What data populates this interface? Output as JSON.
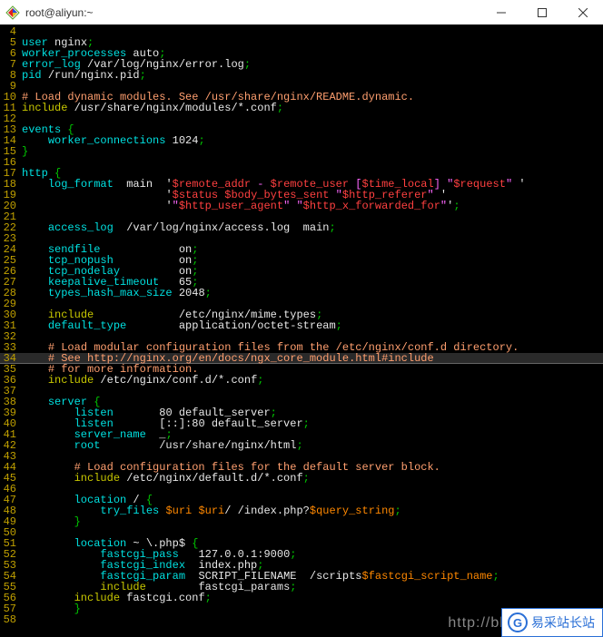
{
  "titlebar": {
    "text": "root@aliyun:~"
  },
  "code_lines": [
    {
      "n": 4,
      "tokens": []
    },
    {
      "n": 5,
      "tokens": [
        {
          "t": "user ",
          "c": "cyan"
        },
        {
          "t": "nginx",
          "c": "white"
        },
        {
          "t": ";",
          "c": "green"
        }
      ]
    },
    {
      "n": 6,
      "tokens": [
        {
          "t": "worker_processes ",
          "c": "cyan"
        },
        {
          "t": "auto",
          "c": "white"
        },
        {
          "t": ";",
          "c": "green"
        }
      ]
    },
    {
      "n": 7,
      "tokens": [
        {
          "t": "error_log ",
          "c": "cyan"
        },
        {
          "t": "/var/log/nginx/error.log",
          "c": "white"
        },
        {
          "t": ";",
          "c": "green"
        }
      ]
    },
    {
      "n": 8,
      "tokens": [
        {
          "t": "pid ",
          "c": "cyan"
        },
        {
          "t": "/run/nginx.pid",
          "c": "white"
        },
        {
          "t": ";",
          "c": "green"
        }
      ]
    },
    {
      "n": 9,
      "tokens": []
    },
    {
      "n": 10,
      "tokens": [
        {
          "t": "# Load dynamic modules. See /usr/share/nginx/README.dynamic.",
          "c": "salmon"
        }
      ]
    },
    {
      "n": 11,
      "tokens": [
        {
          "t": "include ",
          "c": "yellow"
        },
        {
          "t": "/usr/share/nginx/modules/*.conf",
          "c": "white"
        },
        {
          "t": ";",
          "c": "green"
        }
      ]
    },
    {
      "n": 12,
      "tokens": []
    },
    {
      "n": 13,
      "tokens": [
        {
          "t": "events ",
          "c": "cyan"
        },
        {
          "t": "{",
          "c": "green"
        }
      ]
    },
    {
      "n": 14,
      "tokens": [
        {
          "t": "    ",
          "c": "white"
        },
        {
          "t": "worker_connections ",
          "c": "cyan"
        },
        {
          "t": "1024",
          "c": "white"
        },
        {
          "t": ";",
          "c": "green"
        }
      ]
    },
    {
      "n": 15,
      "tokens": [
        {
          "t": "}",
          "c": "green"
        }
      ]
    },
    {
      "n": 16,
      "tokens": []
    },
    {
      "n": 17,
      "tokens": [
        {
          "t": "http ",
          "c": "cyan"
        },
        {
          "t": "{",
          "c": "green"
        }
      ]
    },
    {
      "n": 18,
      "tokens": [
        {
          "t": "    ",
          "c": "white"
        },
        {
          "t": "log_format",
          "c": "cyan"
        },
        {
          "t": "  main  ",
          "c": "white"
        },
        {
          "t": "'",
          "c": "white"
        },
        {
          "t": "$remote_addr",
          "c": "red"
        },
        {
          "t": " - ",
          "c": "magenta"
        },
        {
          "t": "$remote_user",
          "c": "red"
        },
        {
          "t": " [",
          "c": "magenta"
        },
        {
          "t": "$time_local",
          "c": "red"
        },
        {
          "t": "] \"",
          "c": "magenta"
        },
        {
          "t": "$request",
          "c": "red"
        },
        {
          "t": "\" ",
          "c": "magenta"
        },
        {
          "t": "'",
          "c": "white"
        }
      ]
    },
    {
      "n": 19,
      "tokens": [
        {
          "t": "                      ",
          "c": "white"
        },
        {
          "t": "'",
          "c": "white"
        },
        {
          "t": "$status",
          "c": "red"
        },
        {
          "t": " ",
          "c": "magenta"
        },
        {
          "t": "$body_bytes_sent",
          "c": "red"
        },
        {
          "t": " \"",
          "c": "magenta"
        },
        {
          "t": "$http_referer",
          "c": "red"
        },
        {
          "t": "\" ",
          "c": "magenta"
        },
        {
          "t": "'",
          "c": "white"
        }
      ]
    },
    {
      "n": 20,
      "tokens": [
        {
          "t": "                      ",
          "c": "white"
        },
        {
          "t": "'",
          "c": "white"
        },
        {
          "t": "\"",
          "c": "magenta"
        },
        {
          "t": "$http_user_agent",
          "c": "red"
        },
        {
          "t": "\" \"",
          "c": "magenta"
        },
        {
          "t": "$http_x_forwarded_for",
          "c": "red"
        },
        {
          "t": "\"",
          "c": "magenta"
        },
        {
          "t": "'",
          "c": "white"
        },
        {
          "t": ";",
          "c": "green"
        }
      ]
    },
    {
      "n": 21,
      "tokens": []
    },
    {
      "n": 22,
      "tokens": [
        {
          "t": "    ",
          "c": "white"
        },
        {
          "t": "access_log",
          "c": "cyan"
        },
        {
          "t": "  /var/log/nginx/access.log  main",
          "c": "white"
        },
        {
          "t": ";",
          "c": "green"
        }
      ]
    },
    {
      "n": 23,
      "tokens": []
    },
    {
      "n": 24,
      "tokens": [
        {
          "t": "    ",
          "c": "white"
        },
        {
          "t": "sendfile",
          "c": "cyan"
        },
        {
          "t": "            ",
          "c": "white"
        },
        {
          "t": "on",
          "c": "white"
        },
        {
          "t": ";",
          "c": "green"
        }
      ]
    },
    {
      "n": 25,
      "tokens": [
        {
          "t": "    ",
          "c": "white"
        },
        {
          "t": "tcp_nopush",
          "c": "cyan"
        },
        {
          "t": "          ",
          "c": "white"
        },
        {
          "t": "on",
          "c": "white"
        },
        {
          "t": ";",
          "c": "green"
        }
      ]
    },
    {
      "n": 26,
      "tokens": [
        {
          "t": "    ",
          "c": "white"
        },
        {
          "t": "tcp_nodelay",
          "c": "cyan"
        },
        {
          "t": "         ",
          "c": "white"
        },
        {
          "t": "on",
          "c": "white"
        },
        {
          "t": ";",
          "c": "green"
        }
      ]
    },
    {
      "n": 27,
      "tokens": [
        {
          "t": "    ",
          "c": "white"
        },
        {
          "t": "keepalive_timeout",
          "c": "cyan"
        },
        {
          "t": "   65",
          "c": "white"
        },
        {
          "t": ";",
          "c": "green"
        }
      ]
    },
    {
      "n": 28,
      "tokens": [
        {
          "t": "    ",
          "c": "white"
        },
        {
          "t": "types_hash_max_size",
          "c": "cyan"
        },
        {
          "t": " 2048",
          "c": "white"
        },
        {
          "t": ";",
          "c": "green"
        }
      ]
    },
    {
      "n": 29,
      "tokens": []
    },
    {
      "n": 30,
      "tokens": [
        {
          "t": "    ",
          "c": "white"
        },
        {
          "t": "include",
          "c": "yellow"
        },
        {
          "t": "             /etc/nginx/mime.types",
          "c": "white"
        },
        {
          "t": ";",
          "c": "green"
        }
      ]
    },
    {
      "n": 31,
      "tokens": [
        {
          "t": "    ",
          "c": "white"
        },
        {
          "t": "default_type",
          "c": "cyan"
        },
        {
          "t": "        application/octet-stream",
          "c": "white"
        },
        {
          "t": ";",
          "c": "green"
        }
      ]
    },
    {
      "n": 32,
      "tokens": []
    },
    {
      "n": 33,
      "tokens": [
        {
          "t": "    ",
          "c": "white"
        },
        {
          "t": "# Load modular configuration files from the /etc/nginx/conf.d directory.",
          "c": "salmon"
        }
      ]
    },
    {
      "n": 34,
      "cursor": true,
      "tokens": [
        {
          "t": "    ",
          "c": "white"
        },
        {
          "t": "# See http://nginx.org/en/docs/ngx_core_module.html#include",
          "c": "salmon"
        }
      ]
    },
    {
      "n": 35,
      "tokens": [
        {
          "t": "    ",
          "c": "white"
        },
        {
          "t": "# for more information.",
          "c": "salmon"
        }
      ]
    },
    {
      "n": 36,
      "tokens": [
        {
          "t": "    ",
          "c": "white"
        },
        {
          "t": "include",
          "c": "yellow"
        },
        {
          "t": " /etc/nginx/conf.d/*.conf",
          "c": "white"
        },
        {
          "t": ";",
          "c": "green"
        }
      ]
    },
    {
      "n": 37,
      "tokens": []
    },
    {
      "n": 38,
      "tokens": [
        {
          "t": "    ",
          "c": "white"
        },
        {
          "t": "server ",
          "c": "cyan"
        },
        {
          "t": "{",
          "c": "green"
        }
      ]
    },
    {
      "n": 39,
      "tokens": [
        {
          "t": "        ",
          "c": "white"
        },
        {
          "t": "listen",
          "c": "cyan"
        },
        {
          "t": "       80 default_server",
          "c": "white"
        },
        {
          "t": ";",
          "c": "green"
        }
      ]
    },
    {
      "n": 40,
      "tokens": [
        {
          "t": "        ",
          "c": "white"
        },
        {
          "t": "listen",
          "c": "cyan"
        },
        {
          "t": "       [::]:80 default_server",
          "c": "white"
        },
        {
          "t": ";",
          "c": "green"
        }
      ]
    },
    {
      "n": 41,
      "tokens": [
        {
          "t": "        ",
          "c": "white"
        },
        {
          "t": "server_name",
          "c": "cyan"
        },
        {
          "t": "  _",
          "c": "white"
        },
        {
          "t": ";",
          "c": "green"
        }
      ]
    },
    {
      "n": 42,
      "tokens": [
        {
          "t": "        ",
          "c": "white"
        },
        {
          "t": "root",
          "c": "cyan"
        },
        {
          "t": "         /usr/share/nginx/html",
          "c": "white"
        },
        {
          "t": ";",
          "c": "green"
        }
      ]
    },
    {
      "n": 43,
      "tokens": []
    },
    {
      "n": 44,
      "tokens": [
        {
          "t": "        ",
          "c": "white"
        },
        {
          "t": "# Load configuration files for the default server block.",
          "c": "salmon"
        }
      ]
    },
    {
      "n": 45,
      "tokens": [
        {
          "t": "        ",
          "c": "white"
        },
        {
          "t": "include",
          "c": "yellow"
        },
        {
          "t": " /etc/nginx/default.d/*.conf",
          "c": "white"
        },
        {
          "t": ";",
          "c": "green"
        }
      ]
    },
    {
      "n": 46,
      "tokens": []
    },
    {
      "n": 47,
      "tokens": [
        {
          "t": "        ",
          "c": "white"
        },
        {
          "t": "location",
          "c": "cyan"
        },
        {
          "t": " / ",
          "c": "white"
        },
        {
          "t": "{",
          "c": "green"
        }
      ]
    },
    {
      "n": 48,
      "tokens": [
        {
          "t": "            ",
          "c": "white"
        },
        {
          "t": "try_files",
          "c": "cyan"
        },
        {
          "t": " ",
          "c": "white"
        },
        {
          "t": "$uri",
          "c": "orange"
        },
        {
          "t": " ",
          "c": "white"
        },
        {
          "t": "$uri",
          "c": "orange"
        },
        {
          "t": "/ /index.php?",
          "c": "white"
        },
        {
          "t": "$query_string",
          "c": "orange"
        },
        {
          "t": ";",
          "c": "green"
        }
      ]
    },
    {
      "n": 49,
      "tokens": [
        {
          "t": "        ",
          "c": "white"
        },
        {
          "t": "}",
          "c": "green"
        }
      ]
    },
    {
      "n": 50,
      "tokens": []
    },
    {
      "n": 51,
      "tokens": [
        {
          "t": "        ",
          "c": "white"
        },
        {
          "t": "location",
          "c": "cyan"
        },
        {
          "t": " ~ \\.php$ ",
          "c": "white"
        },
        {
          "t": "{",
          "c": "green"
        }
      ]
    },
    {
      "n": 52,
      "tokens": [
        {
          "t": "            ",
          "c": "white"
        },
        {
          "t": "fastcgi_pass",
          "c": "cyan"
        },
        {
          "t": "   127.0.0.1:9000",
          "c": "white"
        },
        {
          "t": ";",
          "c": "green"
        }
      ]
    },
    {
      "n": 53,
      "tokens": [
        {
          "t": "            ",
          "c": "white"
        },
        {
          "t": "fastcgi_index",
          "c": "cyan"
        },
        {
          "t": "  index.php",
          "c": "white"
        },
        {
          "t": ";",
          "c": "green"
        }
      ]
    },
    {
      "n": 54,
      "tokens": [
        {
          "t": "            ",
          "c": "white"
        },
        {
          "t": "fastcgi_param",
          "c": "cyan"
        },
        {
          "t": "  SCRIPT_FILENAME  /scripts",
          "c": "white"
        },
        {
          "t": "$fastcgi_script_name",
          "c": "orange"
        },
        {
          "t": ";",
          "c": "green"
        }
      ]
    },
    {
      "n": 55,
      "tokens": [
        {
          "t": "            ",
          "c": "white"
        },
        {
          "t": "include",
          "c": "yellow"
        },
        {
          "t": "        fastcgi_params",
          "c": "white"
        },
        {
          "t": ";",
          "c": "green"
        }
      ]
    },
    {
      "n": 56,
      "tokens": [
        {
          "t": "        ",
          "c": "white"
        },
        {
          "t": "include",
          "c": "yellow"
        },
        {
          "t": " fastcgi.conf",
          "c": "white"
        },
        {
          "t": ";",
          "c": "green"
        }
      ]
    },
    {
      "n": 57,
      "tokens": [
        {
          "t": "        ",
          "c": "white"
        },
        {
          "t": "}",
          "c": "green"
        }
      ]
    },
    {
      "n": 58,
      "tokens": []
    }
  ],
  "watermark": "http://blog.csdn.net/",
  "badge": {
    "text": "易采站长站"
  }
}
